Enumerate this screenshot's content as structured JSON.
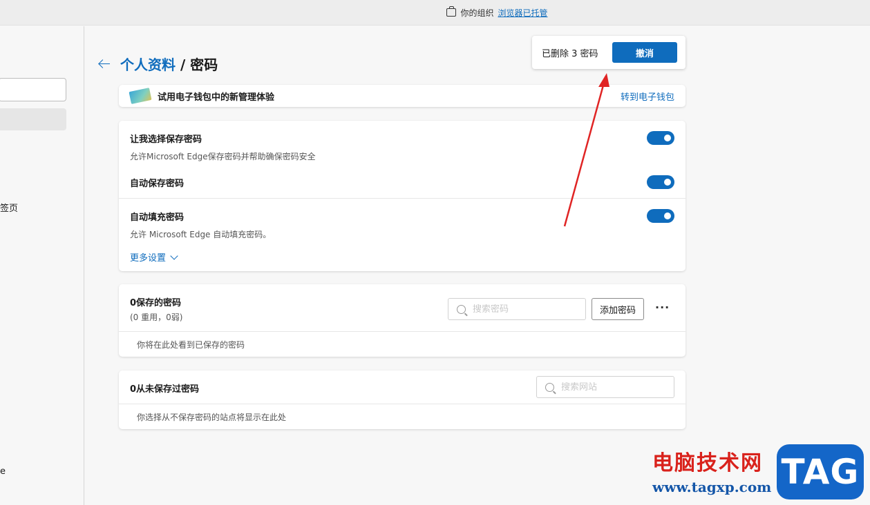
{
  "topbar": {
    "prefix": "你的组织",
    "link": "浏览器已托管"
  },
  "sidebar": {
    "item_tabs_fragment": "签页",
    "item_bottom_fragment": "e"
  },
  "header": {
    "link": "个人资料",
    "separator": " / ",
    "title": "密码"
  },
  "toast": {
    "message": "已删除 3 密码",
    "undo_label": "撤消"
  },
  "wallet": {
    "label": "试用电子钱包中的新管理体验",
    "link": "转到电子钱包"
  },
  "settings": {
    "offer_title": "让我选择保存密码",
    "offer_desc": "允许Microsoft Edge保存密码并帮助确保密码安全",
    "autosave_title": "自动保存密码",
    "autofill_title": "自动填充密码",
    "autofill_desc": "允许 Microsoft Edge 自动填充密码。",
    "more_label": "更多设置"
  },
  "saved": {
    "title": "0保存的密码",
    "subtitle": "(0 重用，0弱)",
    "search_placeholder": "搜索密码",
    "add_label": "添加密码",
    "more_label": "···",
    "empty": "你将在此处看到已保存的密码"
  },
  "never": {
    "title": "0从未保存过密码",
    "search_placeholder": "搜索网站",
    "empty": "你选择从不保存密码的站点将显示在此处"
  },
  "watermark": {
    "cn": "电脑技术网",
    "url": "www.tagxp.com",
    "badge": "TAG"
  },
  "colors": {
    "accent": "#0f6cbd",
    "annotation_arrow": "#e02424"
  }
}
